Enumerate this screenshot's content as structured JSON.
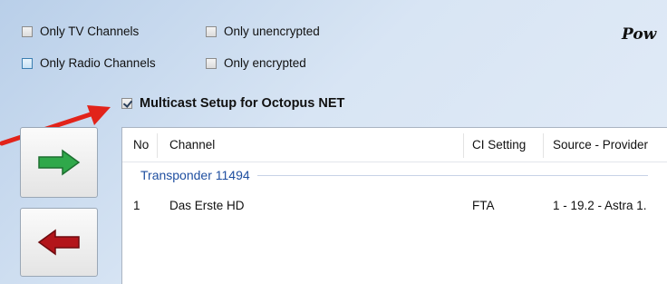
{
  "filters": {
    "only_tv": "Only TV Channels",
    "only_radio": "Only Radio Channels",
    "only_unencrypted": "Only unencrypted",
    "only_encrypted": "Only encrypted"
  },
  "brand_partial": "Pow",
  "multicast": {
    "label": "Multicast Setup for Octopus NET",
    "checked": true
  },
  "buttons": {
    "add_icon": "green-right-arrow-icon",
    "remove_icon": "red-left-arrow-icon"
  },
  "annotation_icon": "red-callout-arrow-icon",
  "table": {
    "columns": [
      "No",
      "Channel",
      "CI Setting",
      "Source - Provider"
    ],
    "group_label": "Transponder 11494",
    "rows": [
      {
        "no": "1",
        "channel": "Das Erste HD",
        "ci": "FTA",
        "source": "1 - 19.2 - Astra 1."
      }
    ]
  },
  "colors": {
    "add_arrow": "#2fa84a",
    "remove_arrow": "#b3151b",
    "callout_arrow": "#e2231a",
    "group_text": "#1f4fa0"
  }
}
